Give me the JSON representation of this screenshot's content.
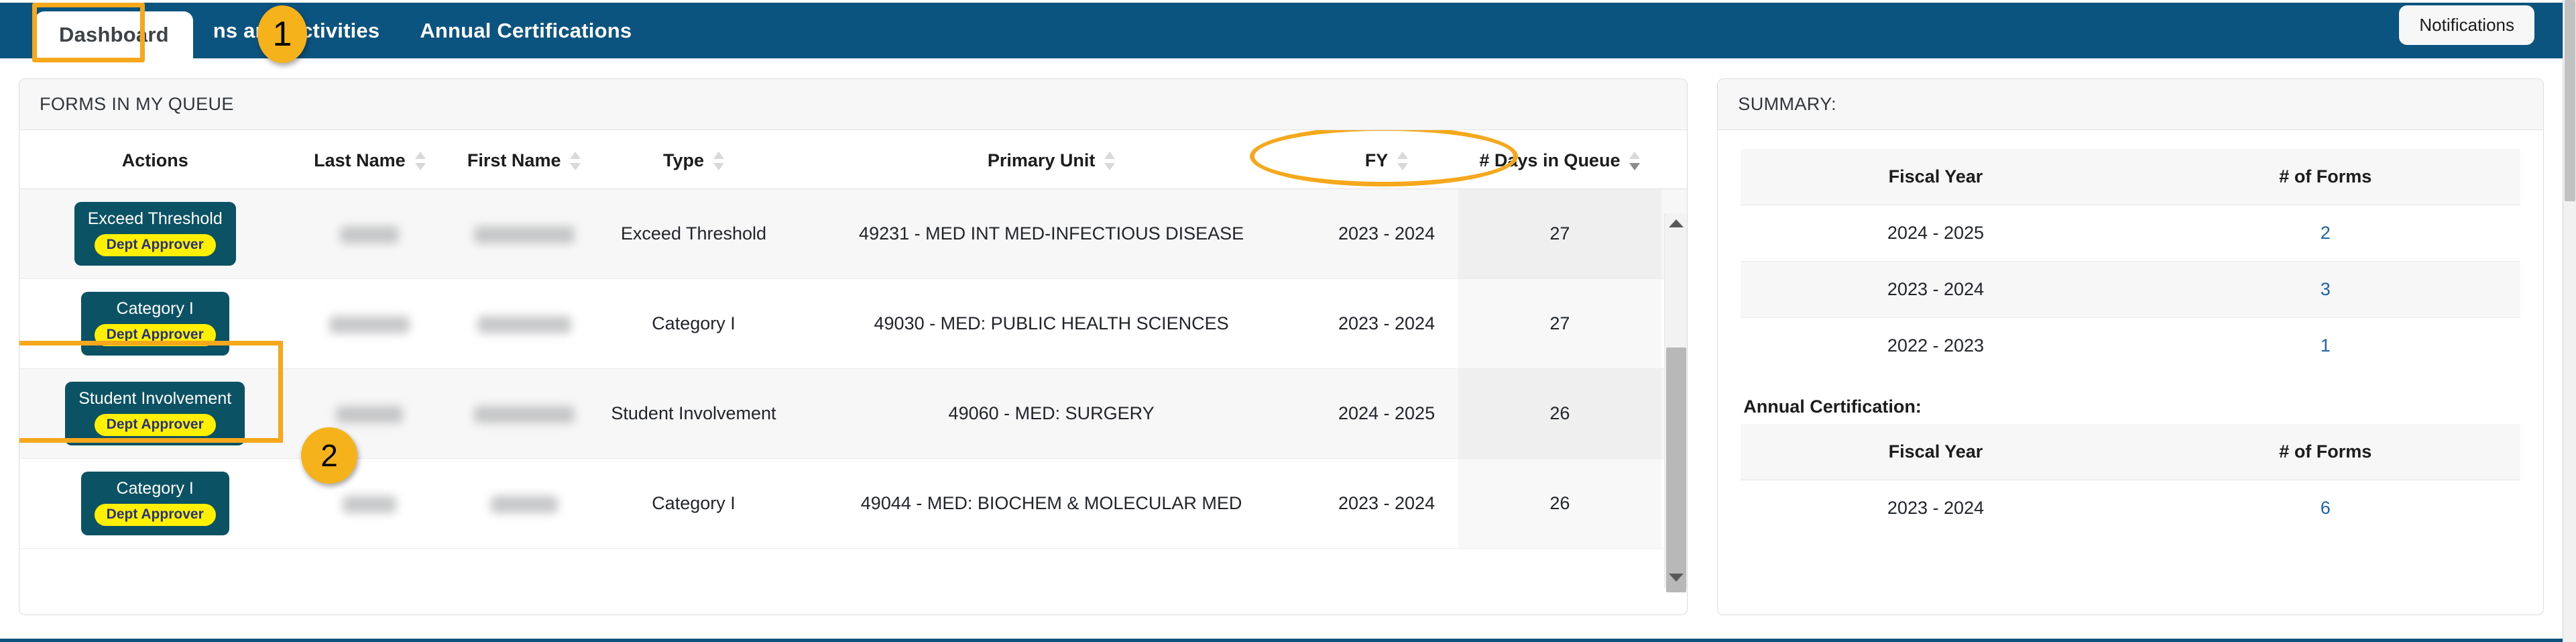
{
  "nav": {
    "tabs": [
      {
        "label": "Dashboard",
        "active": true
      },
      {
        "label": "ns and Activities",
        "active": false
      },
      {
        "label": "Annual Certifications",
        "active": false
      }
    ],
    "notifications_label": "Notifications"
  },
  "callouts": [
    {
      "number": "1"
    },
    {
      "number": "2"
    }
  ],
  "queue": {
    "panel_title": "FORMS IN MY QUEUE",
    "columns": [
      {
        "label": "Actions",
        "sortable": false,
        "sort": "none"
      },
      {
        "label": "Last Name",
        "sortable": true,
        "sort": "none"
      },
      {
        "label": "First Name",
        "sortable": true,
        "sort": "none"
      },
      {
        "label": "Type",
        "sortable": true,
        "sort": "none"
      },
      {
        "label": "Primary Unit",
        "sortable": true,
        "sort": "none"
      },
      {
        "label": "FY",
        "sortable": true,
        "sort": "none"
      },
      {
        "label": "# Days in Queue",
        "sortable": true,
        "sort": "desc"
      }
    ],
    "rows": [
      {
        "action_label": "Exceed Threshold",
        "action_badge": "Dept Approver",
        "last_name": "",
        "first_name": "",
        "type": "Exceed Threshold",
        "primary_unit": "49231 - MED INT MED-INFECTIOUS DISEASE",
        "fy": "2023 - 2024",
        "days_in_queue": "27"
      },
      {
        "action_label": "Category I",
        "action_badge": "Dept Approver",
        "last_name": "",
        "first_name": "",
        "type": "Category I",
        "primary_unit": "49030 - MED: PUBLIC HEALTH SCIENCES",
        "fy": "2023 - 2024",
        "days_in_queue": "27"
      },
      {
        "action_label": "Student Involvement",
        "action_badge": "Dept Approver",
        "last_name": "",
        "first_name": "",
        "type": "Student Involvement",
        "primary_unit": "49060 - MED: SURGERY",
        "fy": "2024 - 2025",
        "days_in_queue": "26"
      },
      {
        "action_label": "Category I",
        "action_badge": "Dept Approver",
        "last_name": "",
        "first_name": "",
        "type": "Category I",
        "primary_unit": "49044 - MED: BIOCHEM & MOLECULAR MED",
        "fy": "2023 - 2024",
        "days_in_queue": "26"
      }
    ]
  },
  "summary": {
    "panel_title": "SUMMARY:",
    "forms_table": {
      "headers": [
        "Fiscal Year",
        "# of Forms"
      ],
      "rows": [
        {
          "fiscal_year": "2024 - 2025",
          "forms": "2"
        },
        {
          "fiscal_year": "2023 - 2024",
          "forms": "3"
        },
        {
          "fiscal_year": "2022 - 2023",
          "forms": "1"
        }
      ]
    },
    "annual_certification_label": "Annual Certification:",
    "certification_table": {
      "headers": [
        "Fiscal Year",
        "# of Forms"
      ],
      "rows": [
        {
          "fiscal_year": "2023 - 2024",
          "forms": "6"
        }
      ]
    }
  },
  "colors": {
    "nav_blue": "#0b5480",
    "highlight_orange": "#f5a81c",
    "button_teal": "#0b5264",
    "badge_yellow": "#ffef00",
    "link_blue": "#1c64a8"
  }
}
